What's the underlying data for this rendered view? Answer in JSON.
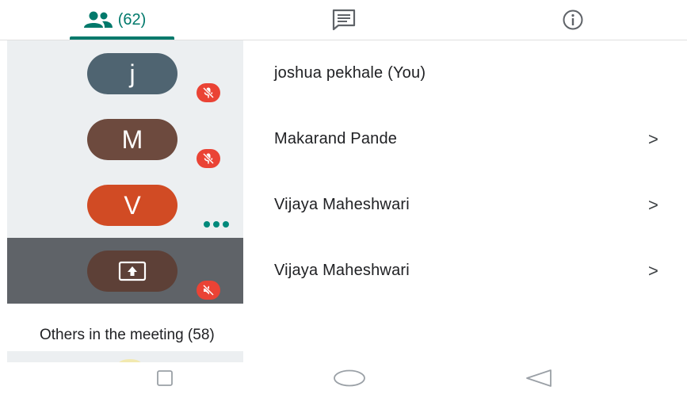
{
  "tabs": {
    "people": {
      "icon": "people-icon",
      "count": "(62)",
      "active": true
    },
    "chat": {
      "icon": "chat-icon"
    },
    "info": {
      "icon": "info-icon"
    }
  },
  "participants": [
    {
      "initial": "j",
      "name": "joshua pekhale (You)",
      "avatar_color": "#4f6471",
      "status": "mic-off",
      "chevron": ""
    },
    {
      "initial": "M",
      "name": "Makarand Pande",
      "avatar_color": "#6d4a3e",
      "status": "mic-off",
      "chevron": ">"
    },
    {
      "initial": "V",
      "name": "Vijaya Maheshwari",
      "avatar_color": "#d14b24",
      "status": "speaking",
      "chevron": ">"
    },
    {
      "initial": "",
      "name": "Vijaya Maheshwari",
      "avatar_color": "#5d4037",
      "status": "presenting-muted",
      "chevron": ">",
      "presenting": true
    }
  ],
  "others_section": {
    "label": "Others in the meeting (58)"
  },
  "navbar": {
    "icons": [
      "recent-apps-icon",
      "home-icon",
      "back-icon"
    ]
  },
  "colors": {
    "accent": "#00796b",
    "muted_badge": "#ea4335",
    "tile_bg": "#eceff1",
    "active_tile_bg": "#5f6368"
  }
}
